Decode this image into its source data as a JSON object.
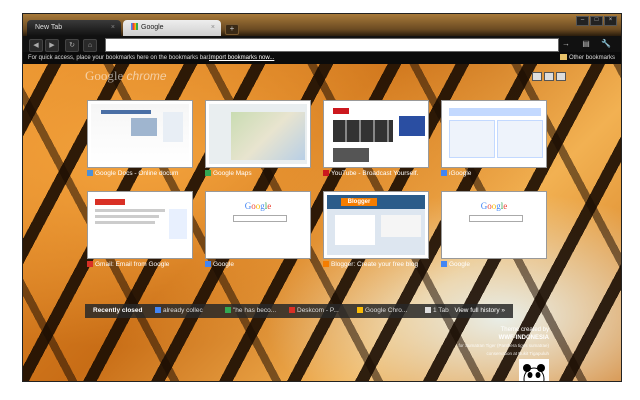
{
  "tabs": [
    {
      "label": "New Tab"
    },
    {
      "label": "Google"
    }
  ],
  "window_controls": [
    "–",
    "□",
    "×"
  ],
  "toolbar": {
    "back": "◀",
    "forward": "▶",
    "reload": "↻",
    "home": "⌂",
    "star": "☆",
    "go": "→",
    "page_menu": "▤",
    "wrench": "🔧"
  },
  "bookmarks_bar": {
    "text": "For quick access, place your bookmarks here on the bookmarks bar.",
    "link": "Import bookmarks now...",
    "other": "Other bookmarks"
  },
  "logo": {
    "google": "Google",
    "chrome": "chrome"
  },
  "thumbnails": [
    {
      "label": "Google Docs - Online docum",
      "favicon": "#4a90d9"
    },
    {
      "label": "Google Maps",
      "favicon": "#34a853"
    },
    {
      "label": "YouTube - Broadcast Yourself.",
      "favicon": "#cc181e"
    },
    {
      "label": "iGoogle",
      "favicon": "#4285f4"
    },
    {
      "label": "Gmail: Email from Google",
      "favicon": "#d93025"
    },
    {
      "label": "Google",
      "favicon": "#4285f4"
    },
    {
      "label": "Blogger: Create your free blog",
      "favicon": "#f57d00"
    },
    {
      "label": "Google",
      "favicon": "#4285f4"
    }
  ],
  "recently_closed": {
    "title": "Recently closed",
    "items": [
      {
        "label": "already collec",
        "color": "#4285f4"
      },
      {
        "label": "\"he has beco...",
        "color": "#34a853"
      },
      {
        "label": "Deskcom - P...",
        "color": "#d93025"
      },
      {
        "label": "Google Chro...",
        "color": "#fbbc05"
      },
      {
        "label": "1 Tab",
        "color": "#dddddd"
      }
    ],
    "history": "View full history »"
  },
  "credits": {
    "line1": "Theme created by",
    "line2": "WWF-INDONESIA",
    "line3": "for Sumatran Tiger (Panthera tigris sumatrae)",
    "line4": "conservation at Bukit Tigapuluh"
  }
}
